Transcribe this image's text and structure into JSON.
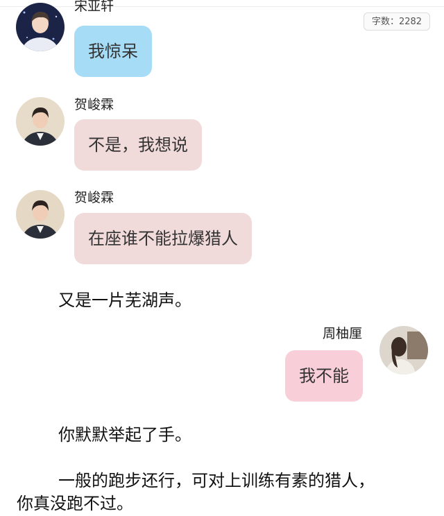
{
  "word_count": "字数：2282",
  "messages": [
    {
      "sender": "宋亚轩",
      "text": "我惊呆",
      "bubble_color": "#a7dcf6"
    },
    {
      "sender": "贺峻霖",
      "text": "不是，我想说",
      "bubble_color": "#f1dada"
    },
    {
      "sender": "贺峻霖",
      "text": "在座谁不能拉爆猎人",
      "bubble_color": "#f1dada"
    },
    {
      "sender": "周柚厘",
      "text": "我不能",
      "bubble_color": "#f8cfd9"
    }
  ],
  "narration": [
    "又是一片芜湖声。",
    "你默默举起了手。",
    "一般的跑步还行，可对上训练有素的猎人，",
    "你真没跑不过。"
  ]
}
